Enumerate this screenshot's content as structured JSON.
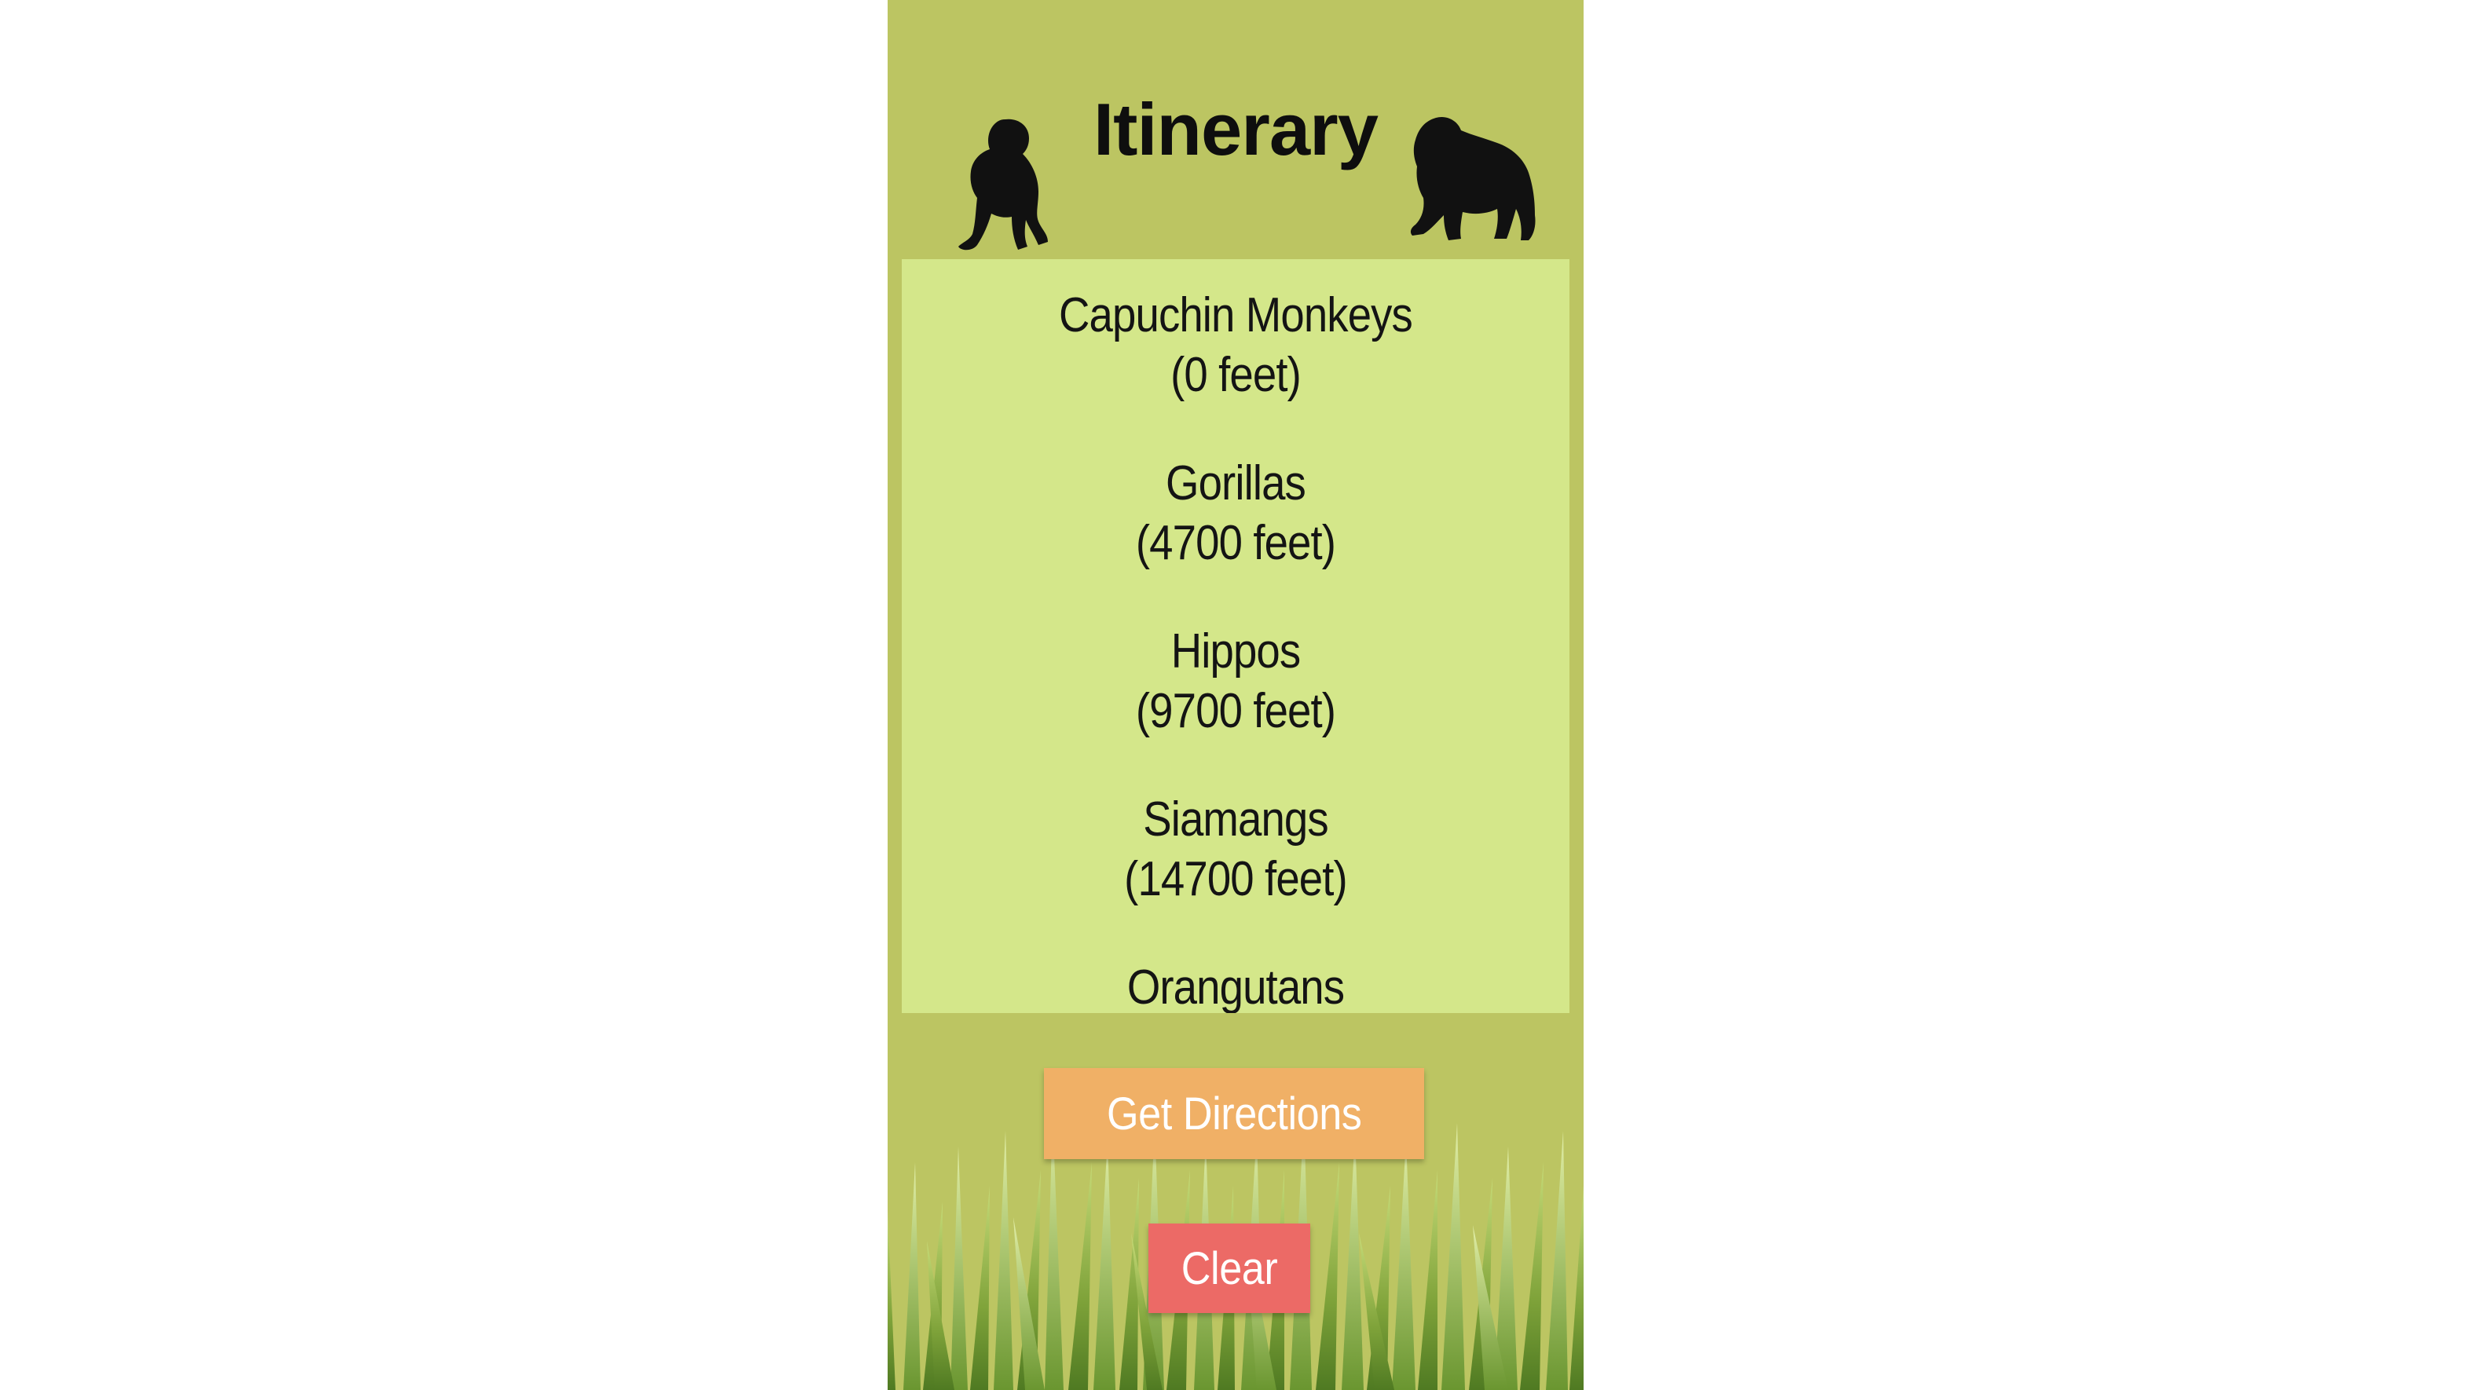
{
  "header": {
    "title": "Itinerary",
    "left_icon": "monkey-silhouette-icon",
    "right_icon": "gorilla-silhouette-icon"
  },
  "itinerary": {
    "items": [
      {
        "name": "Capuchin Monkeys",
        "distance": "(0 feet)"
      },
      {
        "name": "Gorillas",
        "distance": "(4700 feet)"
      },
      {
        "name": "Hippos",
        "distance": "(9700 feet)"
      },
      {
        "name": "Siamangs",
        "distance": "(14700 feet)"
      },
      {
        "name": "Orangutans",
        "distance": ""
      }
    ]
  },
  "actions": {
    "directions_label": "Get Directions",
    "clear_label": "Clear"
  },
  "colors": {
    "background": "#bcc562",
    "list_background": "#d4e78a",
    "directions_button": "#f0b066",
    "clear_button": "#ec6a66"
  }
}
